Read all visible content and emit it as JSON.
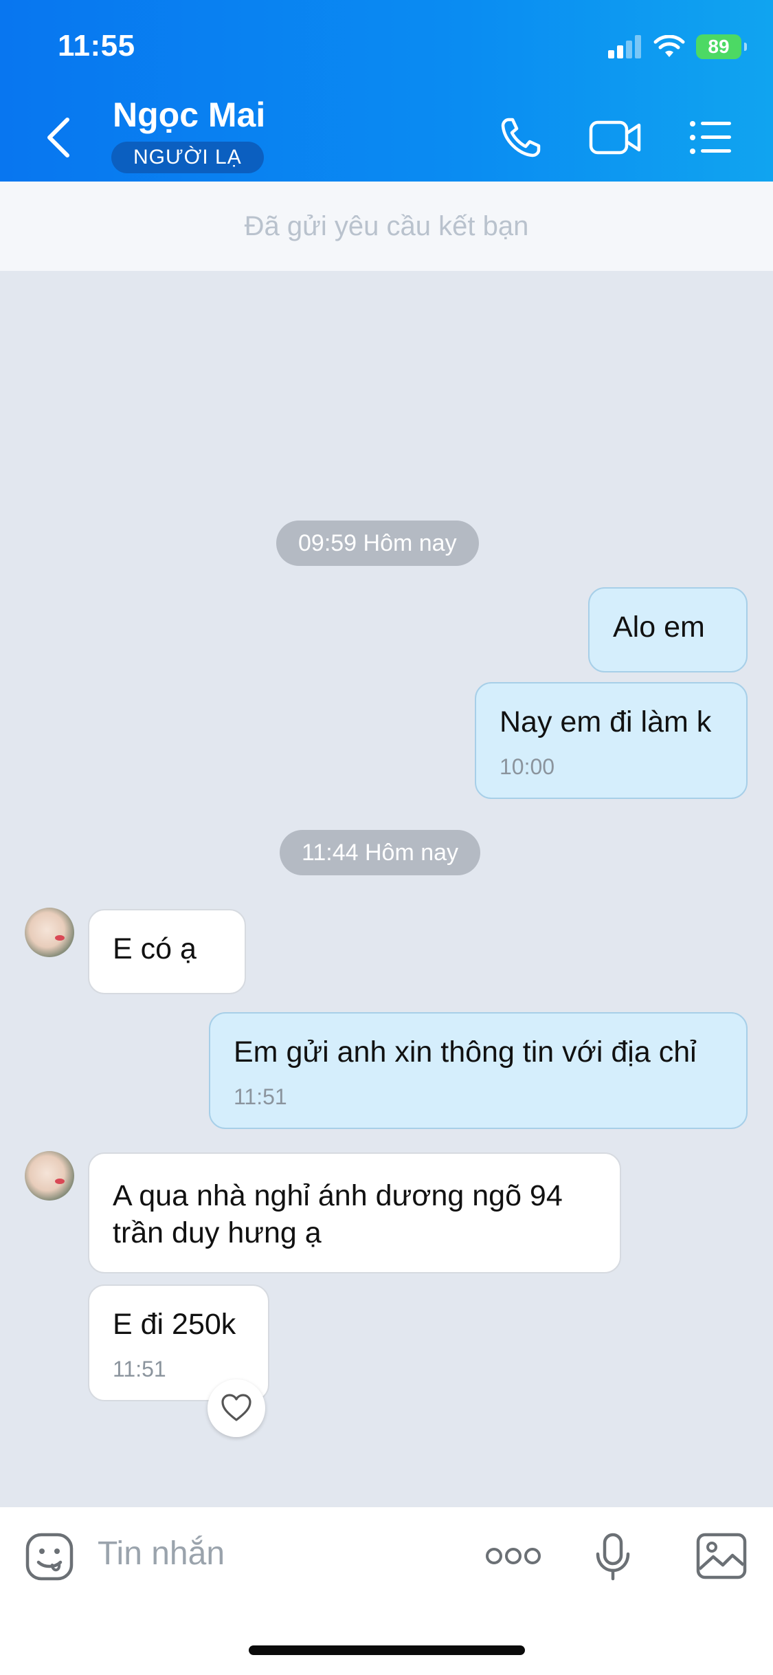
{
  "status_bar": {
    "time": "11:55",
    "battery": "89"
  },
  "header": {
    "contact_name": "Ngọc Mai",
    "badge": "NGƯỜI LẠ"
  },
  "banner": {
    "text": "Đã gửi yêu cầu kết bạn"
  },
  "timestamps": [
    "09:59 Hôm nay",
    "11:44 Hôm nay"
  ],
  "messages": [
    {
      "direction": "out",
      "text": "Alo em",
      "time": ""
    },
    {
      "direction": "out",
      "text": "Nay em đi làm k",
      "time": "10:00"
    },
    {
      "direction": "in",
      "text": "E có ạ",
      "time": ""
    },
    {
      "direction": "out",
      "text": "Em gửi anh xin thông tin với địa chỉ",
      "time": "11:51"
    },
    {
      "direction": "in",
      "text": "A qua nhà nghỉ ánh dương ngõ 94 trần duy hưng ạ",
      "time": ""
    },
    {
      "direction": "in",
      "text": "E đi 250k",
      "time": "11:51"
    }
  ],
  "composer": {
    "placeholder": "Tin nhắn"
  },
  "colors": {
    "header": "#0a86f0",
    "outgoing_bubble": "#d5eefc",
    "incoming_bubble": "#ffffff",
    "background": "#e2e7ef"
  }
}
